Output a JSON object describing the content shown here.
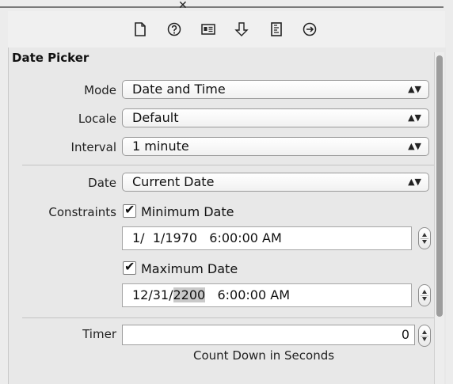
{
  "toolbar": {
    "icons": [
      "file-icon",
      "help-icon",
      "identity-icon",
      "attributes-icon",
      "size-icon",
      "connections-icon"
    ]
  },
  "section_title": "Date Picker",
  "mode": {
    "label": "Mode",
    "value": "Date and Time"
  },
  "locale": {
    "label": "Locale",
    "value": "Default"
  },
  "interval": {
    "label": "Interval",
    "value": "1 minute"
  },
  "date": {
    "label": "Date",
    "value": "Current Date"
  },
  "constraints": {
    "label": "Constraints",
    "minimum": {
      "label": "Minimum Date",
      "checked": true,
      "value": "1/  1/1970   6:00:00 AM"
    },
    "maximum": {
      "label": "Maximum Date",
      "checked": true,
      "value_prefix": "12/31/",
      "value_selected": "2200",
      "value_suffix": "   6:00:00 AM"
    }
  },
  "timer": {
    "label": "Timer",
    "value": "0",
    "caption": "Count Down in Seconds"
  },
  "popup_arrows": "⬍"
}
